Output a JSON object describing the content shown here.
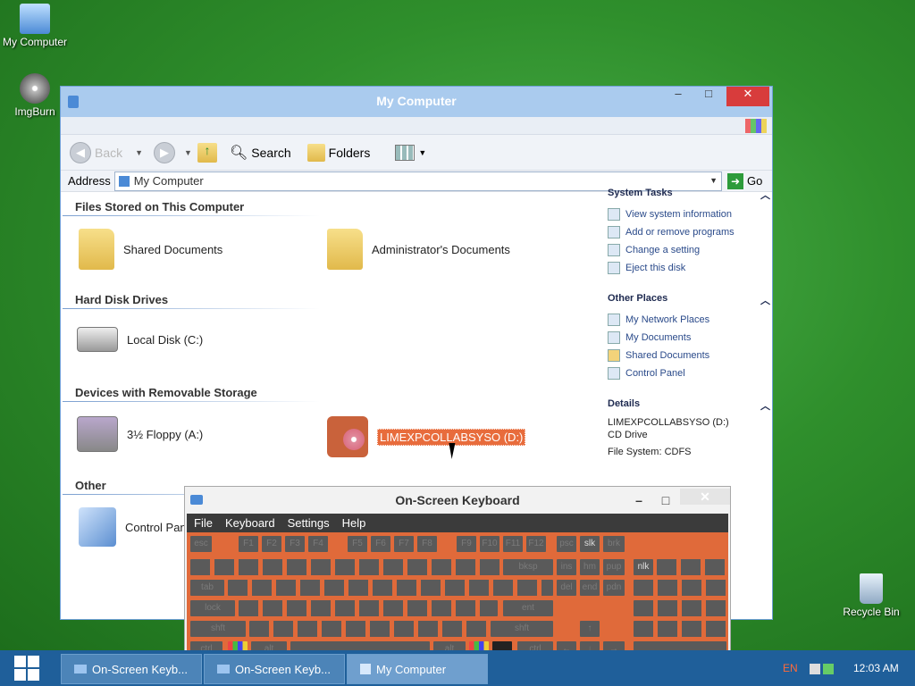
{
  "desktop": {
    "icons": [
      {
        "label": "My Computer",
        "icon": "my-computer-icon"
      },
      {
        "label": "ImgBurn",
        "icon": "imgburn-icon"
      },
      {
        "label": "Recycle Bin",
        "icon": "recycle-bin-icon"
      }
    ]
  },
  "window": {
    "title": "My Computer",
    "buttons": {
      "minimize": "–",
      "maximize": "□",
      "close": "✕"
    },
    "toolbar": {
      "back": "Back",
      "search": "Search",
      "folders": "Folders"
    },
    "address": {
      "label": "Address",
      "value": "My Computer",
      "go": "Go"
    },
    "groups": [
      {
        "heading": "Files Stored on This Computer"
      },
      {
        "heading": "Hard Disk Drives"
      },
      {
        "heading": "Devices with Removable Storage"
      },
      {
        "heading": "Other"
      }
    ],
    "items": {
      "shared_docs": "Shared Documents",
      "admin_docs": "Administrator's Documents",
      "local_disk": "Local Disk (C:)",
      "floppy": "3½ Floppy (A:)",
      "cd_drive": "LIMEXPCOLLABSYSO (D:)",
      "control_panel": "Control Panel"
    },
    "sidebar": {
      "system_tasks": {
        "title": "System Tasks",
        "links": [
          "View system information",
          "Add or remove programs",
          "Change a setting",
          "Eject this disk"
        ]
      },
      "other_places": {
        "title": "Other Places",
        "links": [
          "My Network Places",
          "My Documents",
          "Shared Documents",
          "Control Panel"
        ]
      },
      "details": {
        "title": "Details",
        "name": "LIMEXPCOLLABSYSO (D:)",
        "type": "CD Drive",
        "fs": "File System: CDFS"
      }
    }
  },
  "osk": {
    "title": "On-Screen Keyboard",
    "menu": [
      "File",
      "Keyboard",
      "Settings",
      "Help"
    ],
    "keys": {
      "esc": "esc",
      "f1": "F1",
      "f2": "F2",
      "f3": "F3",
      "f4": "F4",
      "f5": "F5",
      "f6": "F6",
      "f7": "F7",
      "f8": "F8",
      "f9": "F9",
      "f10": "F10",
      "f11": "F11",
      "f12": "F12",
      "psc": "psc",
      "slk": "slk",
      "brk": "brk",
      "bksp": "bksp",
      "tab": "tab",
      "lock": "lock",
      "ent": "ent",
      "shft": "shft",
      "ctrl": "ctrl",
      "alt": "alt",
      "ins": "ins",
      "hm": "hm",
      "pup": "pup",
      "del": "del",
      "end": "end",
      "pdn": "pdn",
      "nlk": "nlk"
    }
  },
  "taskbar": {
    "buttons": [
      "On-Screen Keyb...",
      "On-Screen Keyb...",
      "My Computer"
    ],
    "lang": "EN",
    "time": "12:03 AM"
  }
}
